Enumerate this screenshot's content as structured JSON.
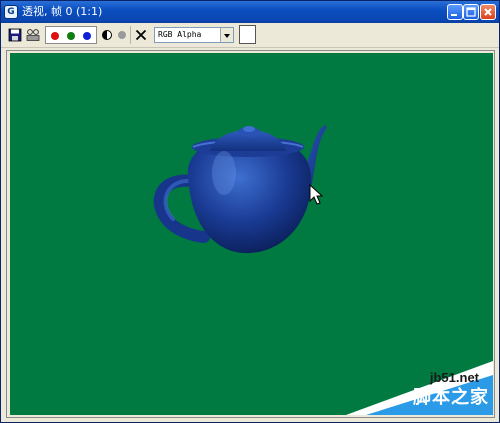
{
  "window": {
    "title": "透视, 帧 0 (1:1)",
    "app_icon_letter": "G",
    "controls": [
      "minimize-icon",
      "maximize-icon",
      "close-icon"
    ]
  },
  "toolbar": {
    "save_icon": "save-icon",
    "clone_icon": "clone-icon",
    "channels": [
      {
        "name": "red-channel",
        "color": "#e01010"
      },
      {
        "name": "green-channel",
        "color": "#0f7d10"
      },
      {
        "name": "blue-channel",
        "color": "#1020d8"
      }
    ],
    "monochrome_icon": "monochrome-icon",
    "alpha_icon": "alpha-dot-icon",
    "clear_icon": "clear-x-icon",
    "channel_select": "RGB Alpha",
    "color_swatch": "#ffffff"
  },
  "viewport": {
    "background": "#007a40",
    "object": "teapot",
    "object_color": "#1f3f9a"
  },
  "watermark": {
    "url": "jb51.net",
    "site": "脚本之家"
  }
}
